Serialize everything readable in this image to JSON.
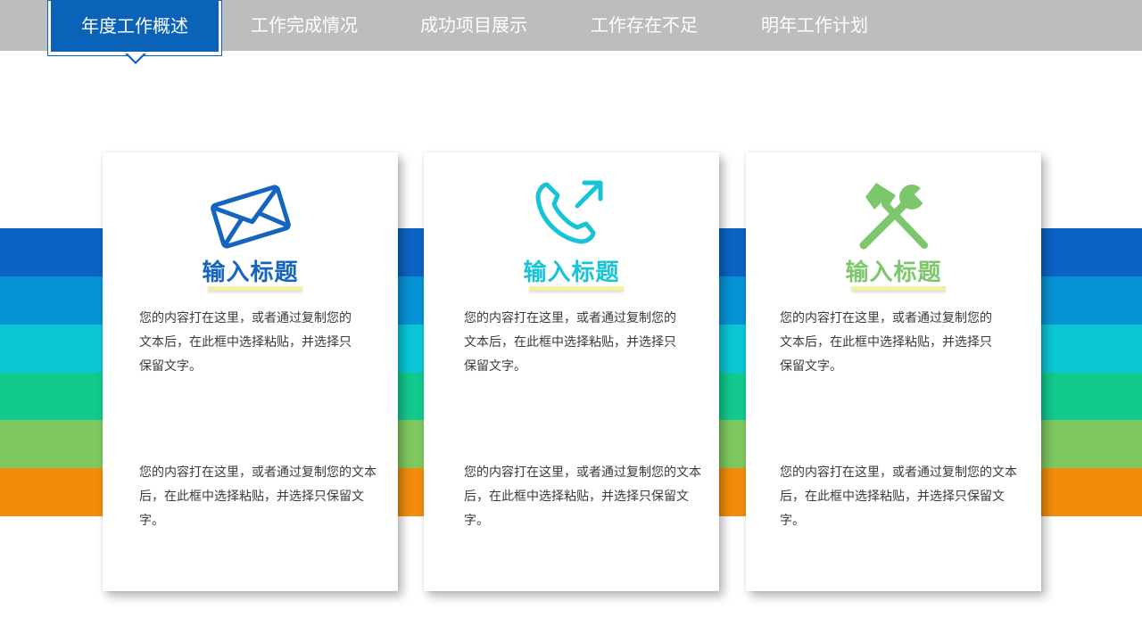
{
  "nav": {
    "tabs": [
      {
        "label": "年度工作概述",
        "active": true
      },
      {
        "label": "工作完成情况",
        "active": false
      },
      {
        "label": "成功项目展示",
        "active": false
      },
      {
        "label": "工作存在不足",
        "active": false
      },
      {
        "label": "明年工作计划",
        "active": false
      }
    ]
  },
  "colors": {
    "nav_bg": "#bdbdbd",
    "active_tab": "#0b63b8",
    "stripes": [
      "#0b63c4",
      "#0693d6",
      "#0bc7d6",
      "#12c98e",
      "#7ec860",
      "#f28c0a"
    ]
  },
  "cards": [
    {
      "icon": "envelope-icon",
      "icon_color": "#1565c0",
      "title": "输入标题",
      "title_color": "#1565c0",
      "text1": "您的内容打在这里，或者通过复制您的文本后，在此框中选择粘贴，并选择只保留文字。",
      "text2": "您的内容打在这里，或者通过复制您的文本后，在此框中选择粘贴，并选择只保留文字。"
    },
    {
      "icon": "phone-outgoing-icon",
      "icon_color": "#17c3d6",
      "title": "输入标题",
      "title_color": "#17c3d6",
      "text1": "您的内容打在这里，或者通过复制您的文本后，在此框中选择粘贴，并选择只保留文字。",
      "text2": "您的内容打在这里，或者通过复制您的文本后，在此框中选择粘贴，并选择只保留文字。"
    },
    {
      "icon": "hammer-wrench-icon",
      "icon_color": "#7cc66b",
      "title": "输入标题",
      "title_color": "#7cc66b",
      "text1": "您的内容打在这里，或者通过复制您的文本后，在此框中选择粘贴，并选择只保留文字。",
      "text2": "您的内容打在这里，或者通过复制您的文本后，在此框中选择粘贴，并选择只保留文字。"
    }
  ]
}
